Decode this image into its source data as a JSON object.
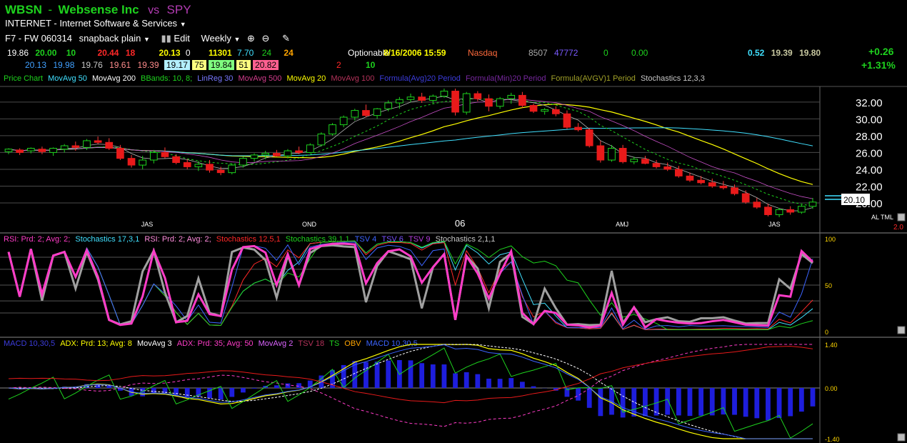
{
  "header": {
    "symbol": "WBSN",
    "dash": "-",
    "company": "Websense Inc",
    "vs": "vs",
    "compare": "SPY",
    "industry": "INTERNET - Internet Software & Services",
    "toolbar": {
      "layout": "F7 - FW",
      "code": "060314",
      "style": "snapback plain",
      "edit": "Edit",
      "period": "Weekly"
    }
  },
  "quotes": {
    "row1": [
      "19.86",
      "20.00",
      "10",
      "20.44",
      "18",
      "20.13",
      "0",
      "11301",
      "7.70",
      "24",
      "24"
    ],
    "row2": [
      "20.13",
      "19.98",
      "19.76",
      "19.61",
      "19.39",
      "19.17",
      "75",
      "19.84",
      "51",
      "20.82"
    ],
    "row3": [
      "2",
      "10"
    ],
    "optionable": "Optionable",
    "datetime": "8/16/2006 15:59",
    "exchange": "Nasdaq",
    "vol1": "8507",
    "vol2": "47772",
    "zero": "0",
    "zerochg": "0.00",
    "right": [
      "0.52",
      "19.39",
      "19.80"
    ],
    "change": "+0.26",
    "change_pct": "+1.31%",
    "colors": {
      "pos": "#1ed21e",
      "neg": "#ff2828",
      "yellow": "#ffff00",
      "cyan": "#40e0ff",
      "orange": "#ffa500"
    }
  },
  "indicators": {
    "price": [
      "Price Chart",
      "MovAvg 50",
      "MovAvg 200",
      "BBands: 10, 8;",
      "LinReg 30",
      "MovAvg 500",
      "MovAvg 20",
      "MovAvg 100",
      "Formula(Avg)20 Period",
      "Formula(Min)20 Period",
      "Formula(AVGV)1 Period",
      "Stochastics 12,3,3"
    ],
    "osc": [
      "RSI: Prd: 2; Avg: 2;",
      "Stochastics 17,3,1",
      "RSI: Prd: 2; Avg: 2;",
      "Stochastics 12,5,1",
      "Stochastics 39,1,1",
      "TSV 4",
      "TSV 6",
      "TSV 9",
      "Stochastics 2,1,1"
    ],
    "macd": [
      "MACD 10,30,5",
      "ADX: Prd: 13; Avg: 8",
      "MovAvg 3",
      "ADX: Prd: 35; Avg: 50",
      "MovAvg 2",
      "TSV 18",
      "TS",
      "OBV",
      "MACD 10,30,5"
    ]
  },
  "price_panel": {
    "last_price": "20.10",
    "scale_flags": "AL TML",
    "scale_number": "2.0",
    "time_labels": [
      "JAS",
      "OND",
      "06",
      "AMJ",
      "JAS"
    ]
  },
  "osc_scale": [
    "100",
    "50",
    "0"
  ],
  "macd_scale": [
    "1.40",
    "0.00",
    "-1.40"
  ],
  "chart_data": [
    {
      "type": "candlestick",
      "title": "WBSN - Websense Inc vs SPY",
      "ylabel": "",
      "y_ticks": [
        20,
        22,
        24,
        26,
        28,
        30,
        32
      ],
      "ylim": [
        18.3,
        33.6
      ],
      "x_period_labels": [
        "JAS",
        "OND",
        "06",
        "AMJ",
        "JAS"
      ],
      "candles": [
        [
          26.1,
          26.5,
          25.8,
          26.4
        ],
        [
          26.3,
          26.5,
          25.7,
          26.0
        ],
        [
          26.2,
          26.6,
          25.9,
          26.5
        ],
        [
          26.4,
          26.7,
          25.8,
          26.1
        ],
        [
          26.0,
          26.6,
          25.6,
          26.5
        ],
        [
          26.4,
          27.0,
          26.0,
          26.8
        ],
        [
          26.8,
          27.3,
          26.2,
          26.6
        ],
        [
          26.6,
          27.6,
          26.3,
          27.4
        ],
        [
          27.4,
          27.9,
          27.0,
          27.2
        ],
        [
          27.2,
          27.7,
          26.3,
          26.5
        ],
        [
          26.5,
          26.9,
          25.1,
          25.3
        ],
        [
          25.3,
          25.7,
          24.2,
          24.5
        ],
        [
          24.5,
          25.6,
          24.0,
          25.1
        ],
        [
          25.1,
          26.3,
          24.7,
          26.0
        ],
        [
          26.0,
          26.6,
          25.3,
          25.5
        ],
        [
          25.5,
          25.8,
          24.6,
          24.8
        ],
        [
          24.8,
          25.2,
          24.0,
          24.3
        ],
        [
          24.3,
          25.0,
          23.8,
          24.6
        ],
        [
          24.6,
          25.1,
          23.6,
          23.9
        ],
        [
          23.9,
          24.3,
          23.3,
          23.6
        ],
        [
          23.6,
          24.7,
          23.4,
          24.5
        ],
        [
          24.5,
          25.5,
          24.2,
          25.3
        ],
        [
          25.3,
          25.9,
          24.9,
          25.7
        ],
        [
          25.7,
          26.2,
          25.2,
          25.9
        ],
        [
          25.9,
          26.3,
          25.5,
          25.6
        ],
        [
          25.6,
          26.4,
          25.3,
          26.2
        ],
        [
          26.2,
          26.7,
          25.8,
          26.0
        ],
        [
          26.0,
          27.1,
          25.9,
          26.9
        ],
        [
          26.9,
          28.4,
          26.7,
          28.2
        ],
        [
          28.2,
          29.5,
          28.0,
          29.3
        ],
        [
          29.3,
          30.4,
          29.0,
          30.2
        ],
        [
          30.2,
          31.2,
          29.8,
          31.0
        ],
        [
          31.0,
          31.7,
          30.2,
          30.4
        ],
        [
          30.4,
          31.3,
          30.0,
          31.2
        ],
        [
          31.2,
          32.2,
          30.9,
          31.9
        ],
        [
          31.9,
          32.6,
          31.2,
          32.3
        ],
        [
          32.3,
          33.0,
          32.0,
          32.6
        ],
        [
          32.6,
          33.1,
          31.9,
          32.2
        ],
        [
          32.2,
          32.9,
          31.8,
          32.7
        ],
        [
          32.7,
          33.6,
          32.5,
          33.3
        ],
        [
          33.3,
          33.6,
          30.4,
          30.8
        ],
        [
          30.8,
          33.2,
          30.5,
          33.0
        ],
        [
          33.0,
          33.3,
          32.1,
          32.4
        ],
        [
          32.4,
          32.9,
          30.9,
          31.5
        ],
        [
          31.5,
          32.6,
          31.2,
          32.4
        ],
        [
          32.4,
          33.1,
          31.8,
          32.8
        ],
        [
          32.8,
          33.2,
          31.3,
          31.6
        ],
        [
          31.6,
          31.8,
          30.7,
          30.9
        ],
        [
          30.9,
          31.3,
          30.5,
          31.1
        ],
        [
          31.1,
          31.5,
          30.3,
          30.6
        ],
        [
          30.6,
          31.0,
          28.8,
          29.0
        ],
        [
          29.0,
          29.5,
          28.5,
          28.7
        ],
        [
          28.7,
          28.9,
          26.6,
          26.8
        ],
        [
          26.8,
          27.4,
          24.8,
          25.1
        ],
        [
          25.1,
          26.9,
          24.9,
          26.5
        ],
        [
          26.5,
          26.9,
          24.7,
          24.9
        ],
        [
          24.9,
          25.5,
          24.6,
          25.2
        ],
        [
          25.2,
          25.6,
          24.6,
          24.7
        ],
        [
          24.7,
          25.1,
          24.1,
          24.3
        ],
        [
          24.3,
          24.8,
          23.8,
          24.0
        ],
        [
          24.0,
          24.4,
          23.0,
          23.2
        ],
        [
          23.2,
          23.6,
          22.5,
          22.7
        ],
        [
          22.7,
          23.2,
          22.2,
          22.4
        ],
        [
          22.4,
          22.9,
          21.8,
          22.0
        ],
        [
          22.0,
          22.6,
          21.6,
          21.8
        ],
        [
          21.8,
          22.2,
          20.9,
          21.1
        ],
        [
          21.1,
          21.5,
          19.9,
          20.1
        ],
        [
          20.1,
          20.6,
          19.3,
          19.5
        ],
        [
          19.5,
          19.9,
          18.4,
          18.6
        ],
        [
          18.6,
          19.4,
          18.3,
          19.2
        ],
        [
          19.2,
          19.6,
          18.6,
          18.9
        ],
        [
          18.9,
          19.8,
          18.7,
          19.6
        ],
        [
          19.6,
          20.6,
          19.3,
          20.1
        ]
      ]
    }
  ]
}
